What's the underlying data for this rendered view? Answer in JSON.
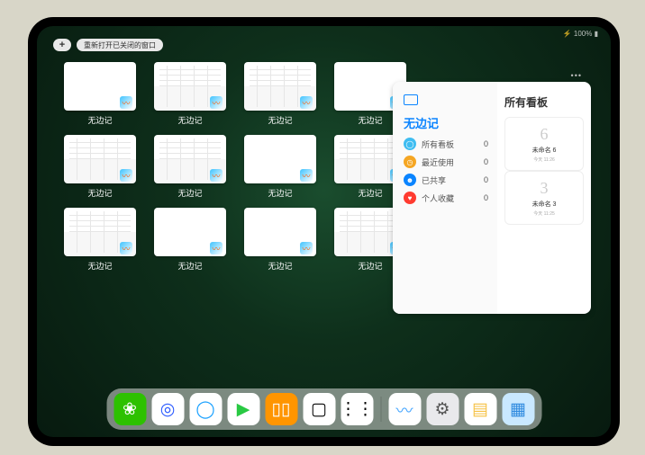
{
  "status": "⚡ 100% ▮",
  "topbar": {
    "plus": "+",
    "pill": "重新打开已关闭的窗口"
  },
  "windows": [
    {
      "label": "无边记",
      "variant": "blank"
    },
    {
      "label": "无边记",
      "variant": "half"
    },
    {
      "label": "无边记",
      "variant": "half"
    },
    {
      "label": "无边记",
      "variant": "blank"
    },
    {
      "label": "无边记",
      "variant": "half"
    },
    {
      "label": "无边记",
      "variant": "half"
    },
    {
      "label": "无边记",
      "variant": "blank"
    },
    {
      "label": "无边记",
      "variant": "half"
    },
    {
      "label": "无边记",
      "variant": "half"
    },
    {
      "label": "无边记",
      "variant": "blank"
    },
    {
      "label": "无边记",
      "variant": "blank"
    },
    {
      "label": "无边记",
      "variant": "half"
    }
  ],
  "panel": {
    "left_title": "无边记",
    "right_title": "所有看板",
    "rows": [
      {
        "icon": "◯",
        "bg": "#3fbdf1",
        "label": "所有看板",
        "count": "0"
      },
      {
        "icon": "◷",
        "bg": "#f5a623",
        "label": "最近使用",
        "count": "0"
      },
      {
        "icon": "☻",
        "bg": "#0a84ff",
        "label": "已共享",
        "count": "0"
      },
      {
        "icon": "♥",
        "bg": "#ff3b30",
        "label": "个人收藏",
        "count": "0"
      }
    ],
    "cards": [
      {
        "sketch": "6",
        "title": "未命名 6",
        "sub": "今天 11:26"
      },
      {
        "sketch": "3",
        "title": "未命名 3",
        "sub": "今天 11:25"
      }
    ]
  },
  "dock": [
    {
      "name": "wechat",
      "bg": "#2dc100",
      "glyph": "❀",
      "c": "#fff"
    },
    {
      "name": "quark",
      "bg": "#fff",
      "glyph": "◎",
      "c": "#2b5aff"
    },
    {
      "name": "qqbrowser",
      "bg": "#fff",
      "glyph": "◯",
      "c": "#18a0ff"
    },
    {
      "name": "play",
      "bg": "#fff",
      "glyph": "▶",
      "c": "#29c943"
    },
    {
      "name": "books",
      "bg": "#ff9500",
      "glyph": "▯▯",
      "c": "#fff"
    },
    {
      "name": "dice",
      "bg": "#fff",
      "glyph": "▢",
      "c": "#000"
    },
    {
      "name": "nodes",
      "bg": "#fff",
      "glyph": "⋮⋮",
      "c": "#000"
    },
    {
      "sep": true
    },
    {
      "name": "freeform",
      "bg": "#fff",
      "glyph": "〰",
      "c": "#4aa8ff"
    },
    {
      "name": "settings",
      "bg": "#e9e9ec",
      "glyph": "⚙",
      "c": "#555"
    },
    {
      "name": "notes",
      "bg": "#fff",
      "glyph": "▤",
      "c": "#f6c244"
    },
    {
      "name": "folder",
      "bg": "#c9e8ff",
      "glyph": "▦",
      "c": "#2f8adf"
    }
  ]
}
